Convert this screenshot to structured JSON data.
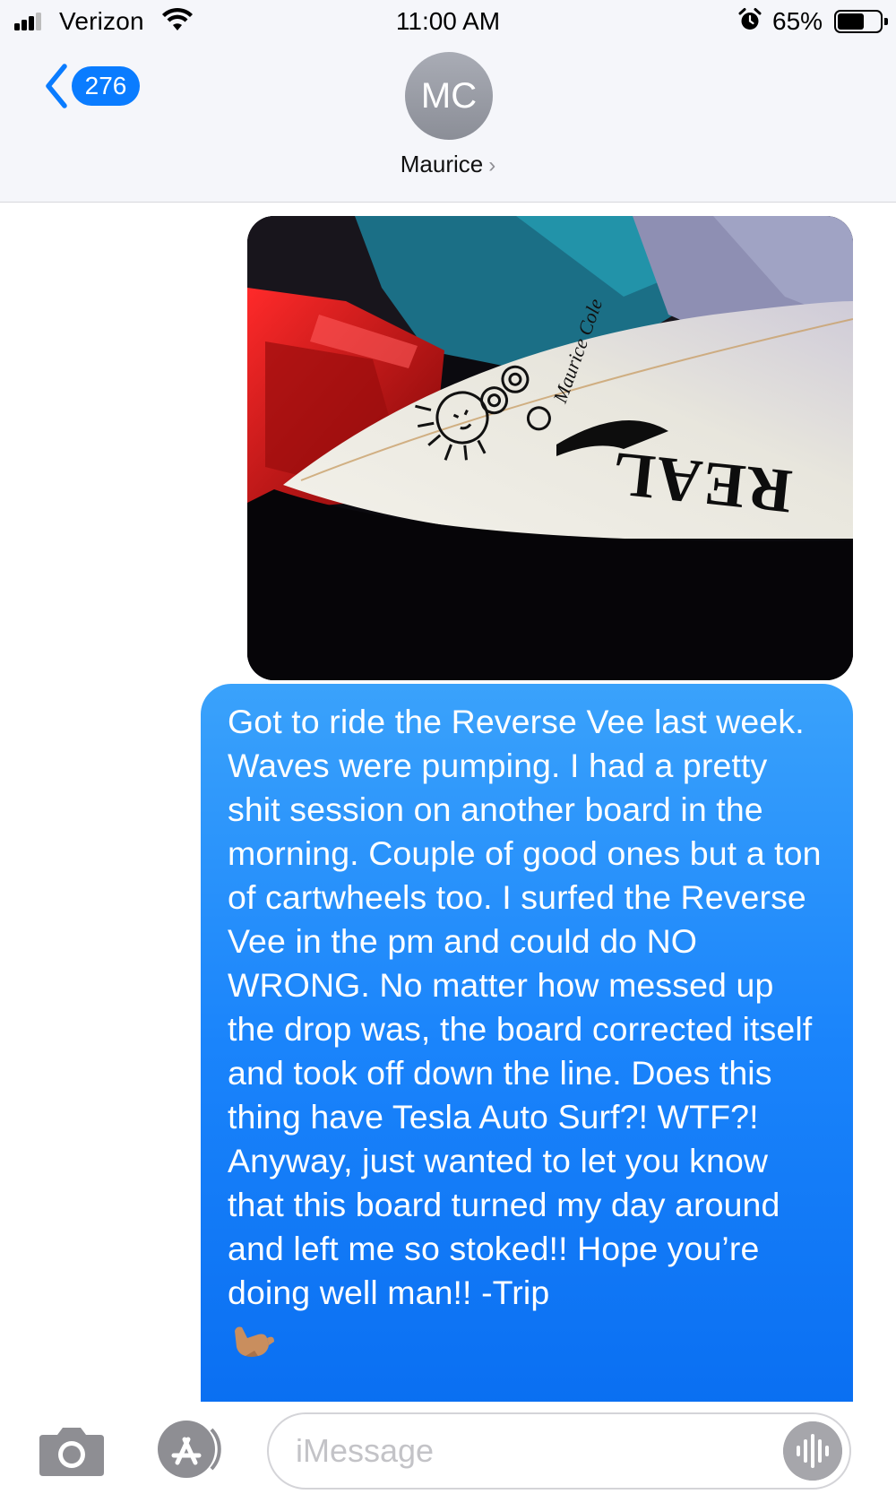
{
  "status_bar": {
    "carrier": "Verizon",
    "time": "11:00 AM",
    "battery_percent": "65%",
    "battery_level": 0.65,
    "signal_icon": "cellular-signal-icon",
    "wifi_icon": "wifi-icon",
    "alarm_icon": "alarm-clock-icon"
  },
  "header": {
    "back_badge_count": "276",
    "avatar_initials": "MC",
    "contact_name": "Maurice",
    "contact_chevron": "›"
  },
  "photo": {
    "description_icon": "surfboard-photo",
    "board_text": "REAL"
  },
  "message": {
    "text": "Got to ride the Reverse Vee last week. Waves were pumping. I had a pretty shit session on another board in the morning. Couple of good ones but a ton of cartwheels too. I surfed the Reverse Vee in the pm and could do NO WRONG. No matter how messed up the drop was, the board corrected itself and took off down the line. Does this thing have Tesla Auto Surf?! WTF?! Anyway, just wanted to let you know that this board turned my day around and left me so stoked!! Hope you’re doing well man!! -Trip",
    "emoji": "call-me-hand-emoji"
  },
  "input_bar": {
    "placeholder": "iMessage",
    "camera_icon": "camera-icon",
    "apps_icon": "app-store-icon",
    "audio_icon": "audio-waveform-icon"
  },
  "colors": {
    "accent": "#0a7cff",
    "bubble_top": "#3aa2fb",
    "bubble_bottom": "#0a6ff2",
    "header_bg": "#f5f6fa"
  }
}
